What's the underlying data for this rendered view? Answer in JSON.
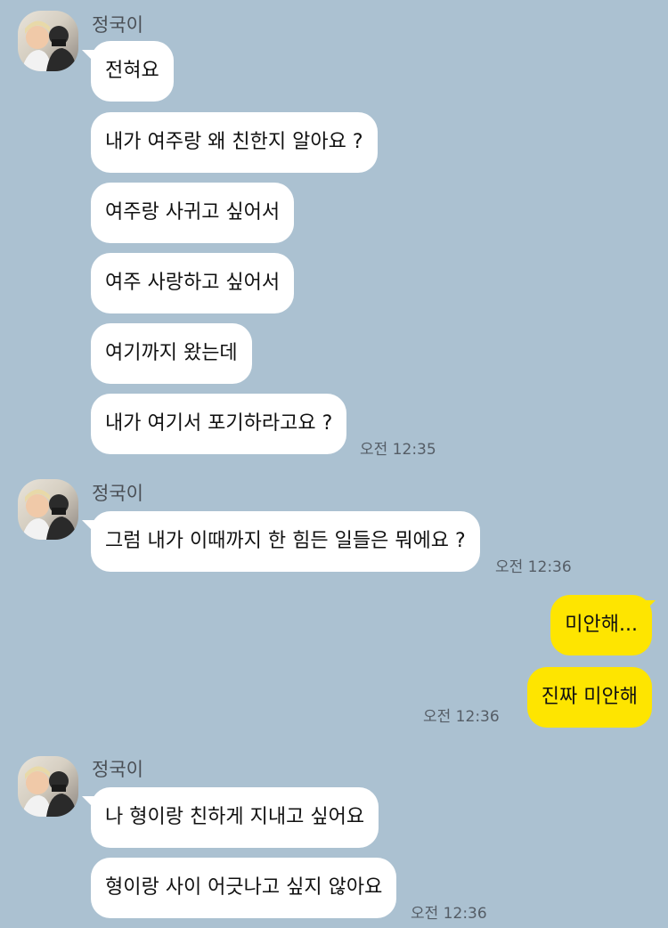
{
  "colors": {
    "background": "#abc1d1",
    "incoming_bubble": "#ffffff",
    "outgoing_bubble": "#fee500"
  },
  "groups": [
    {
      "sender": "정국이",
      "messages": [
        "전혀요",
        "내가 여주랑 왜 친한지 알아요 ?",
        "여주랑 사귀고 싶어서",
        "여주 사랑하고 싶어서",
        "여기까지 왔는데",
        "내가 여기서 포기하라고요 ?"
      ],
      "time": "오전 12:35"
    },
    {
      "sender": "정국이",
      "messages": [
        "그럼 내가 이때까지 한 힘든 일들은 뭐에요 ?"
      ],
      "time": "오전 12:36"
    },
    {
      "sender": "",
      "messages": [
        "미안해...",
        "진짜 미안해"
      ],
      "time": "오전 12:36"
    },
    {
      "sender": "정국이",
      "messages": [
        "나 형이랑 친하게 지내고 싶어요",
        "형이랑 사이 어긋나고 싶지 않아요"
      ],
      "time": "오전 12:36"
    }
  ]
}
